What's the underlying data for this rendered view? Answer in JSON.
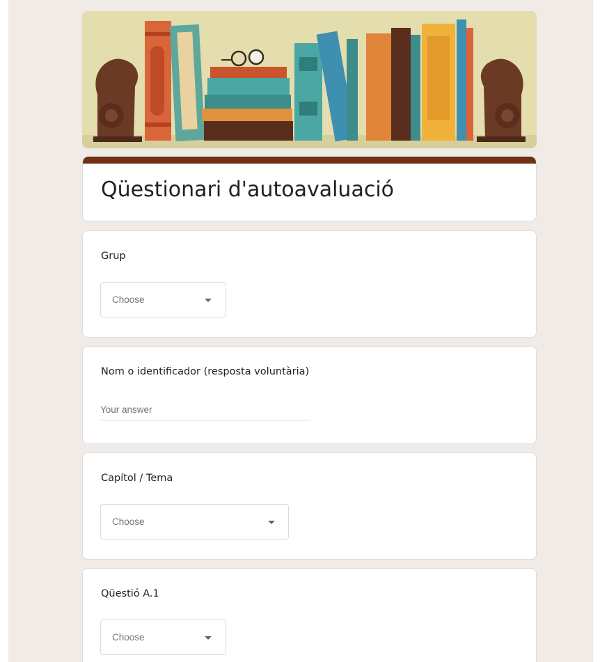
{
  "form": {
    "title": "Qüestionari d'autoavaluació",
    "header_color": "#6e3114",
    "background_color": "#f0ebe7"
  },
  "banner": {
    "icon": "bookshelf-banner-illustration"
  },
  "questions": [
    {
      "label": "Grup",
      "type": "dropdown",
      "value": "Choose"
    },
    {
      "label": "Nom o identificador (resposta voluntària)",
      "type": "short-text",
      "placeholder": "Your answer"
    },
    {
      "label": "Capítol / Tema",
      "type": "dropdown",
      "value": "Choose"
    },
    {
      "label": "Qüestió A.1",
      "type": "dropdown",
      "value": "Choose"
    }
  ]
}
